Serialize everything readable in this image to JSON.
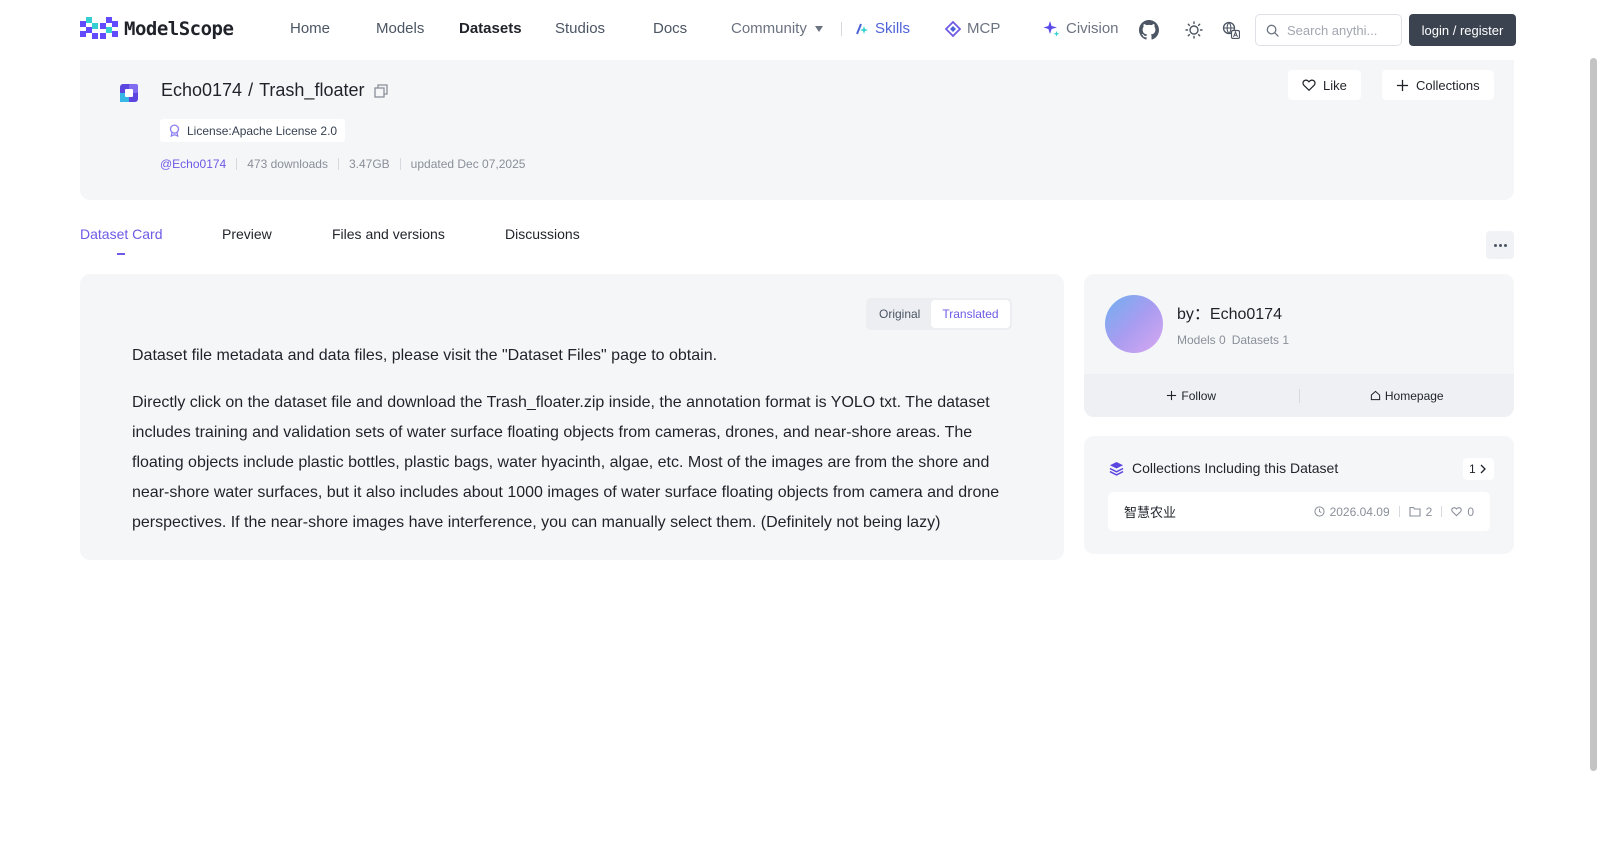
{
  "brand": {
    "name": "ModelScope"
  },
  "nav": {
    "links": [
      "Home",
      "Models",
      "Datasets",
      "Studios",
      "Docs"
    ],
    "community": "Community",
    "skills": "Skills",
    "mcp": "MCP",
    "civision": "Civision",
    "search_placeholder": "Search anythi...",
    "login": "login / register"
  },
  "dataset": {
    "owner": "Echo0174",
    "separator": "/",
    "name": "Trash_floater",
    "license": "License:Apache License 2.0",
    "author_handle": "@Echo0174",
    "downloads": "473 downloads",
    "size": "3.47GB",
    "updated": "updated Dec 07,2025",
    "like": "Like",
    "collections": "Collections"
  },
  "tabs": [
    "Dataset Card",
    "Preview",
    "Files and versions",
    "Discussions"
  ],
  "card": {
    "toggle_original": "Original",
    "toggle_translated": "Translated",
    "para1": "Dataset file metadata and data files, please visit the \"Dataset Files\" page to obtain.",
    "para2": "Directly click on the dataset file and download the Trash_floater.zip inside, the annotation format is YOLO txt. The dataset includes training and validation sets of water surface floating objects from cameras, drones, and near-shore areas. The floating objects include plastic bottles, plastic bags, water hyacinth, algae, etc. Most of the images are from the shore and near-shore water surfaces, but it also includes about 1000 images of water surface floating objects from camera and drone perspectives. If the near-shore images have interference, you can manually select them. (Definitely not being lazy)"
  },
  "author": {
    "by": "by：Echo0174",
    "models": "Models 0",
    "datasets": "Datasets 1",
    "follow": "Follow",
    "homepage": "Homepage"
  },
  "collections_box": {
    "title": "Collections Including this Dataset",
    "count": "1",
    "items": [
      {
        "name": "智慧农业",
        "date": "2026.04.09",
        "items": "2",
        "likes": "0"
      }
    ]
  },
  "colors": {
    "accent": "#6d5ae6",
    "skills": "#4f63d8",
    "login_bg": "#3c4350"
  },
  "icons": [
    "logo-mark-icon",
    "chevron-down-icon",
    "skills-icon",
    "mcp-icon",
    "sparkle-icon",
    "github-icon",
    "sun-icon",
    "translate-icon",
    "search-icon",
    "dataset-icon",
    "copy-icon",
    "badge-icon",
    "heart-icon",
    "plus-icon",
    "more-icon",
    "home-icon",
    "layers-icon",
    "chevron-right-icon",
    "clock-icon",
    "folder-icon"
  ]
}
